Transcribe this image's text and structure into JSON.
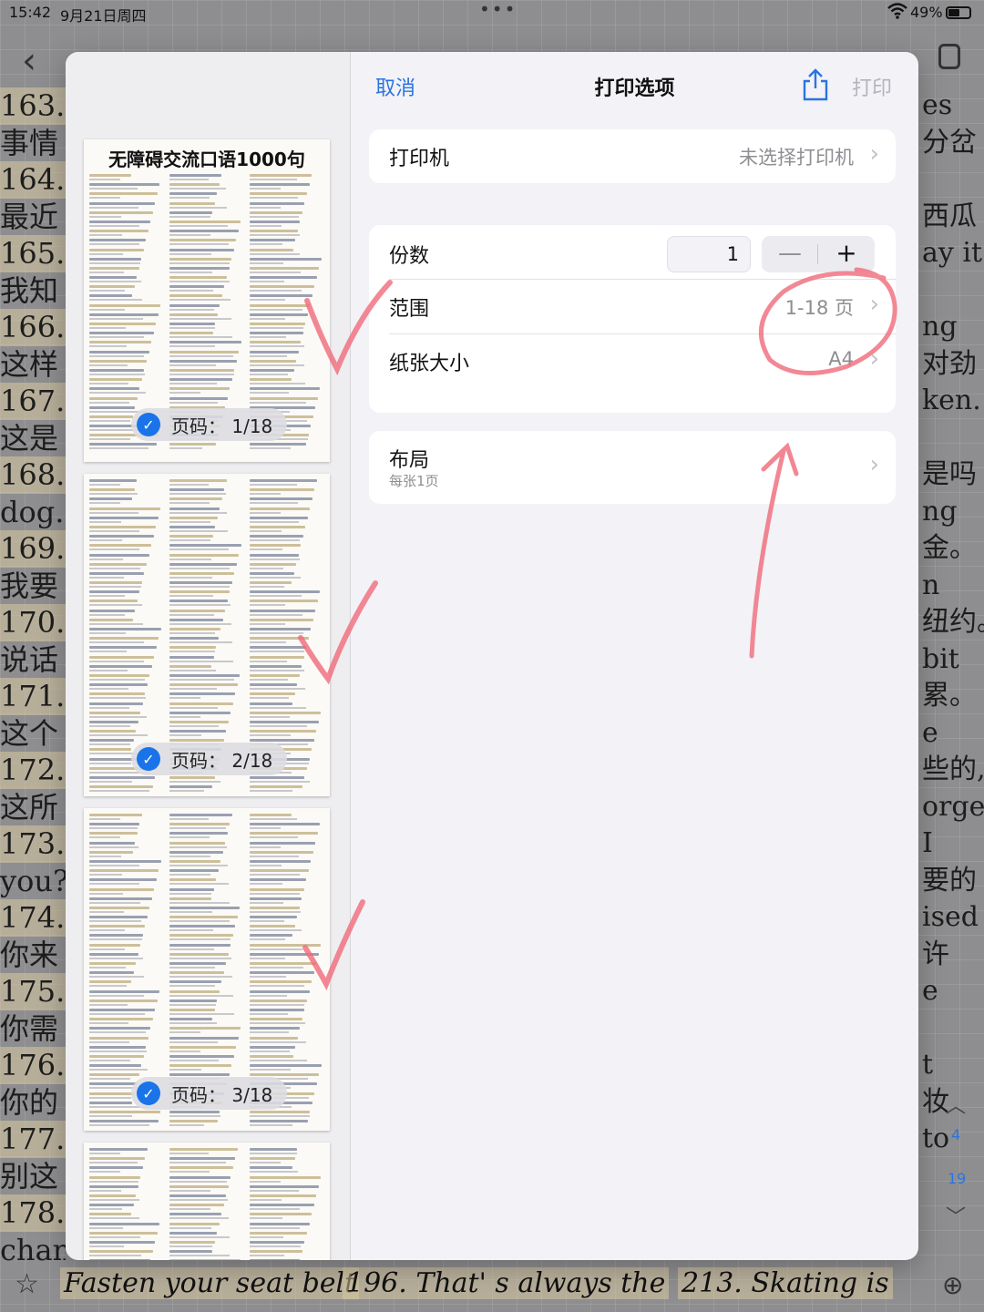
{
  "status_bar": {
    "time": "15:42",
    "date": "9月21日周四",
    "battery": "49%"
  },
  "background_notes": {
    "left_lines": [
      "163.",
      "事情",
      "164.",
      "最近",
      "165.",
      "我知",
      "166.",
      "这样",
      "167.",
      "这是",
      "168.",
      "dog.",
      "169.",
      "我要",
      "170.",
      "说话",
      "171.",
      "这个",
      "172.",
      "这所",
      "173.",
      "you?",
      "174.",
      "你来",
      "175.",
      "你需",
      "176.",
      "你的",
      "177.",
      "别这",
      "178.",
      "chan"
    ],
    "right_lines": [
      "es",
      "分岔",
      "",
      "西瓜",
      "ay it",
      "",
      "ng",
      "对劲",
      "ken.",
      "",
      "是吗",
      "ng",
      "金。",
      "n",
      "纽约。",
      "bit",
      "累。",
      "e",
      "些的,",
      "orget",
      "I",
      "要的",
      "ised",
      "许",
      "e",
      "",
      "t",
      "妆",
      "to",
      ""
    ],
    "bottom_texts": [
      "Fasten your seat belt",
      "196. That' s always the",
      "213. Skating is"
    ],
    "side_page_numbers": [
      "4",
      "19"
    ]
  },
  "print_dialog": {
    "cancel_label": "取消",
    "title": "打印选项",
    "print_label": "打印",
    "printer_label": "打印机",
    "printer_value": "未选择打印机",
    "copies_label": "份数",
    "copies_value": "1",
    "minus_label": "—",
    "plus_label": "+",
    "range_label": "范围",
    "range_value": "1-18 页",
    "paper_label": "纸张大小",
    "paper_value": "A4",
    "layout_label": "布局",
    "layout_sub": "每张1页"
  },
  "preview": {
    "doc_title": "无障碍交流口语1000句",
    "pages": [
      {
        "badge": "页码： 1/18"
      },
      {
        "badge": "页码： 2/18"
      },
      {
        "badge": "页码： 3/18"
      },
      {
        "badge": ""
      }
    ]
  },
  "colors": {
    "accent": "#2a74e0",
    "annotation": "#f06a7a",
    "checkmark": "#1a73e8"
  }
}
